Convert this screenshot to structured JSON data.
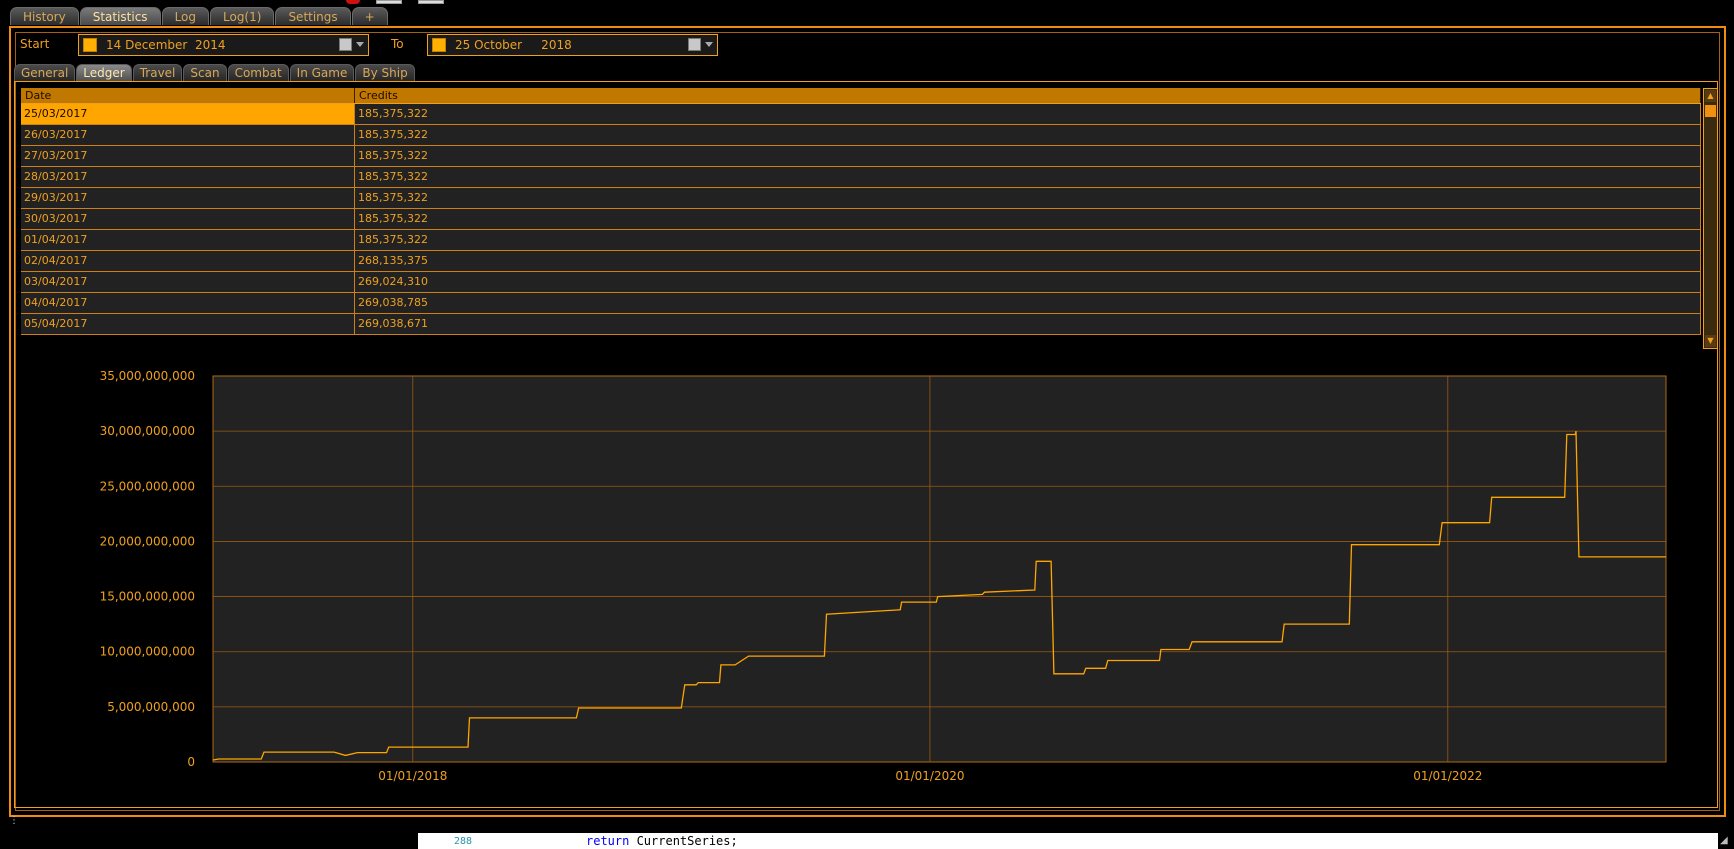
{
  "top_tabs": [
    {
      "label": "History",
      "active": false
    },
    {
      "label": "Statistics",
      "active": true
    },
    {
      "label": "Log",
      "active": false
    },
    {
      "label": "Log(1)",
      "active": false
    },
    {
      "label": "Settings",
      "active": false
    },
    {
      "label": "+",
      "active": false
    }
  ],
  "date_range": {
    "start_label": "Start",
    "start_value": "14 December  2014",
    "to_label": "To",
    "to_value": "25 October     2018"
  },
  "sub_tabs": [
    {
      "label": "General",
      "active": false
    },
    {
      "label": "Ledger",
      "active": true
    },
    {
      "label": "Travel",
      "active": false
    },
    {
      "label": "Scan",
      "active": false
    },
    {
      "label": "Combat",
      "active": false
    },
    {
      "label": "In Game",
      "active": false
    },
    {
      "label": "By Ship",
      "active": false
    }
  ],
  "ledger": {
    "headers": [
      "Date",
      "Credits"
    ],
    "rows": [
      {
        "date": "25/03/2017",
        "credits": "185,375,322",
        "selected": true
      },
      {
        "date": "26/03/2017",
        "credits": "185,375,322",
        "selected": false
      },
      {
        "date": "27/03/2017",
        "credits": "185,375,322",
        "selected": false
      },
      {
        "date": "28/03/2017",
        "credits": "185,375,322",
        "selected": false
      },
      {
        "date": "29/03/2017",
        "credits": "185,375,322",
        "selected": false
      },
      {
        "date": "30/03/2017",
        "credits": "185,375,322",
        "selected": false
      },
      {
        "date": "01/04/2017",
        "credits": "185,375,322",
        "selected": false
      },
      {
        "date": "02/04/2017",
        "credits": "268,135,375",
        "selected": false
      },
      {
        "date": "03/04/2017",
        "credits": "269,024,310",
        "selected": false
      },
      {
        "date": "04/04/2017",
        "credits": "269,038,785",
        "selected": false
      },
      {
        "date": "05/04/2017",
        "credits": "269,038,671",
        "selected": false
      }
    ]
  },
  "chart_data": {
    "type": "line",
    "title": "",
    "xlabel": "",
    "ylabel": "",
    "x_ticks": [
      "01/01/2018",
      "01/01/2020",
      "01/01/2022"
    ],
    "y_ticks": [
      "0",
      "5,000,000,000",
      "10,000,000,000",
      "15,000,000,000",
      "20,000,000,000",
      "25,000,000,000",
      "30,000,000,000",
      "35,000,000,000"
    ],
    "xlim": [
      "2017-03-25",
      "2022-11-05"
    ],
    "ylim": [
      0,
      35000000000
    ],
    "grid": true,
    "line_color": "#ffa500",
    "series": [
      {
        "points": [
          [
            "2017-03-25",
            185375322
          ],
          [
            "2017-04-02",
            269038671
          ],
          [
            "2017-06-01",
            269038671
          ],
          [
            "2017-06-05",
            900000000
          ],
          [
            "2017-09-12",
            900000000
          ],
          [
            "2017-09-28",
            600000000
          ],
          [
            "2017-10-15",
            850000000
          ],
          [
            "2017-11-25",
            850000000
          ],
          [
            "2017-11-28",
            1350000000
          ],
          [
            "2018-03-20",
            1350000000
          ],
          [
            "2018-03-22",
            4000000000
          ],
          [
            "2018-08-20",
            4000000000
          ],
          [
            "2018-08-23",
            4900000000
          ],
          [
            "2019-01-15",
            4900000000
          ],
          [
            "2019-01-20",
            7000000000
          ],
          [
            "2019-02-05",
            7000000000
          ],
          [
            "2019-02-08",
            7200000000
          ],
          [
            "2019-03-10",
            7200000000
          ],
          [
            "2019-03-12",
            8800000000
          ],
          [
            "2019-04-01",
            8800000000
          ],
          [
            "2019-04-20",
            9600000000
          ],
          [
            "2019-08-05",
            9600000000
          ],
          [
            "2019-08-08",
            13400000000
          ],
          [
            "2019-11-20",
            13800000000
          ],
          [
            "2019-11-22",
            14500000000
          ],
          [
            "2020-01-10",
            14500000000
          ],
          [
            "2020-01-12",
            15000000000
          ],
          [
            "2020-03-15",
            15200000000
          ],
          [
            "2020-03-18",
            15400000000
          ],
          [
            "2020-05-28",
            15600000000
          ],
          [
            "2020-05-30",
            18200000000
          ],
          [
            "2020-06-20",
            18200000000
          ],
          [
            "2020-06-24",
            8000000000
          ],
          [
            "2020-08-05",
            8000000000
          ],
          [
            "2020-08-08",
            8500000000
          ],
          [
            "2020-09-05",
            8500000000
          ],
          [
            "2020-09-08",
            9200000000
          ],
          [
            "2020-11-20",
            9200000000
          ],
          [
            "2020-11-22",
            10200000000
          ],
          [
            "2021-01-01",
            10200000000
          ],
          [
            "2021-01-05",
            10900000000
          ],
          [
            "2021-05-12",
            10900000000
          ],
          [
            "2021-05-15",
            12500000000
          ],
          [
            "2021-08-15",
            12500000000
          ],
          [
            "2021-08-18",
            19700000000
          ],
          [
            "2021-12-20",
            19700000000
          ],
          [
            "2021-12-24",
            21700000000
          ],
          [
            "2022-03-01",
            21700000000
          ],
          [
            "2022-03-04",
            24000000000
          ],
          [
            "2022-06-15",
            24000000000
          ],
          [
            "2022-06-18",
            29700000000
          ],
          [
            "2022-06-30",
            29700000000
          ],
          [
            "2022-07-01",
            30000000000
          ],
          [
            "2022-07-05",
            18600000000
          ],
          [
            "2022-11-05",
            18600000000
          ]
        ]
      }
    ]
  },
  "code_peek": {
    "line_number": "288",
    "keyword": "return",
    "text": " CurrentSeries;"
  }
}
